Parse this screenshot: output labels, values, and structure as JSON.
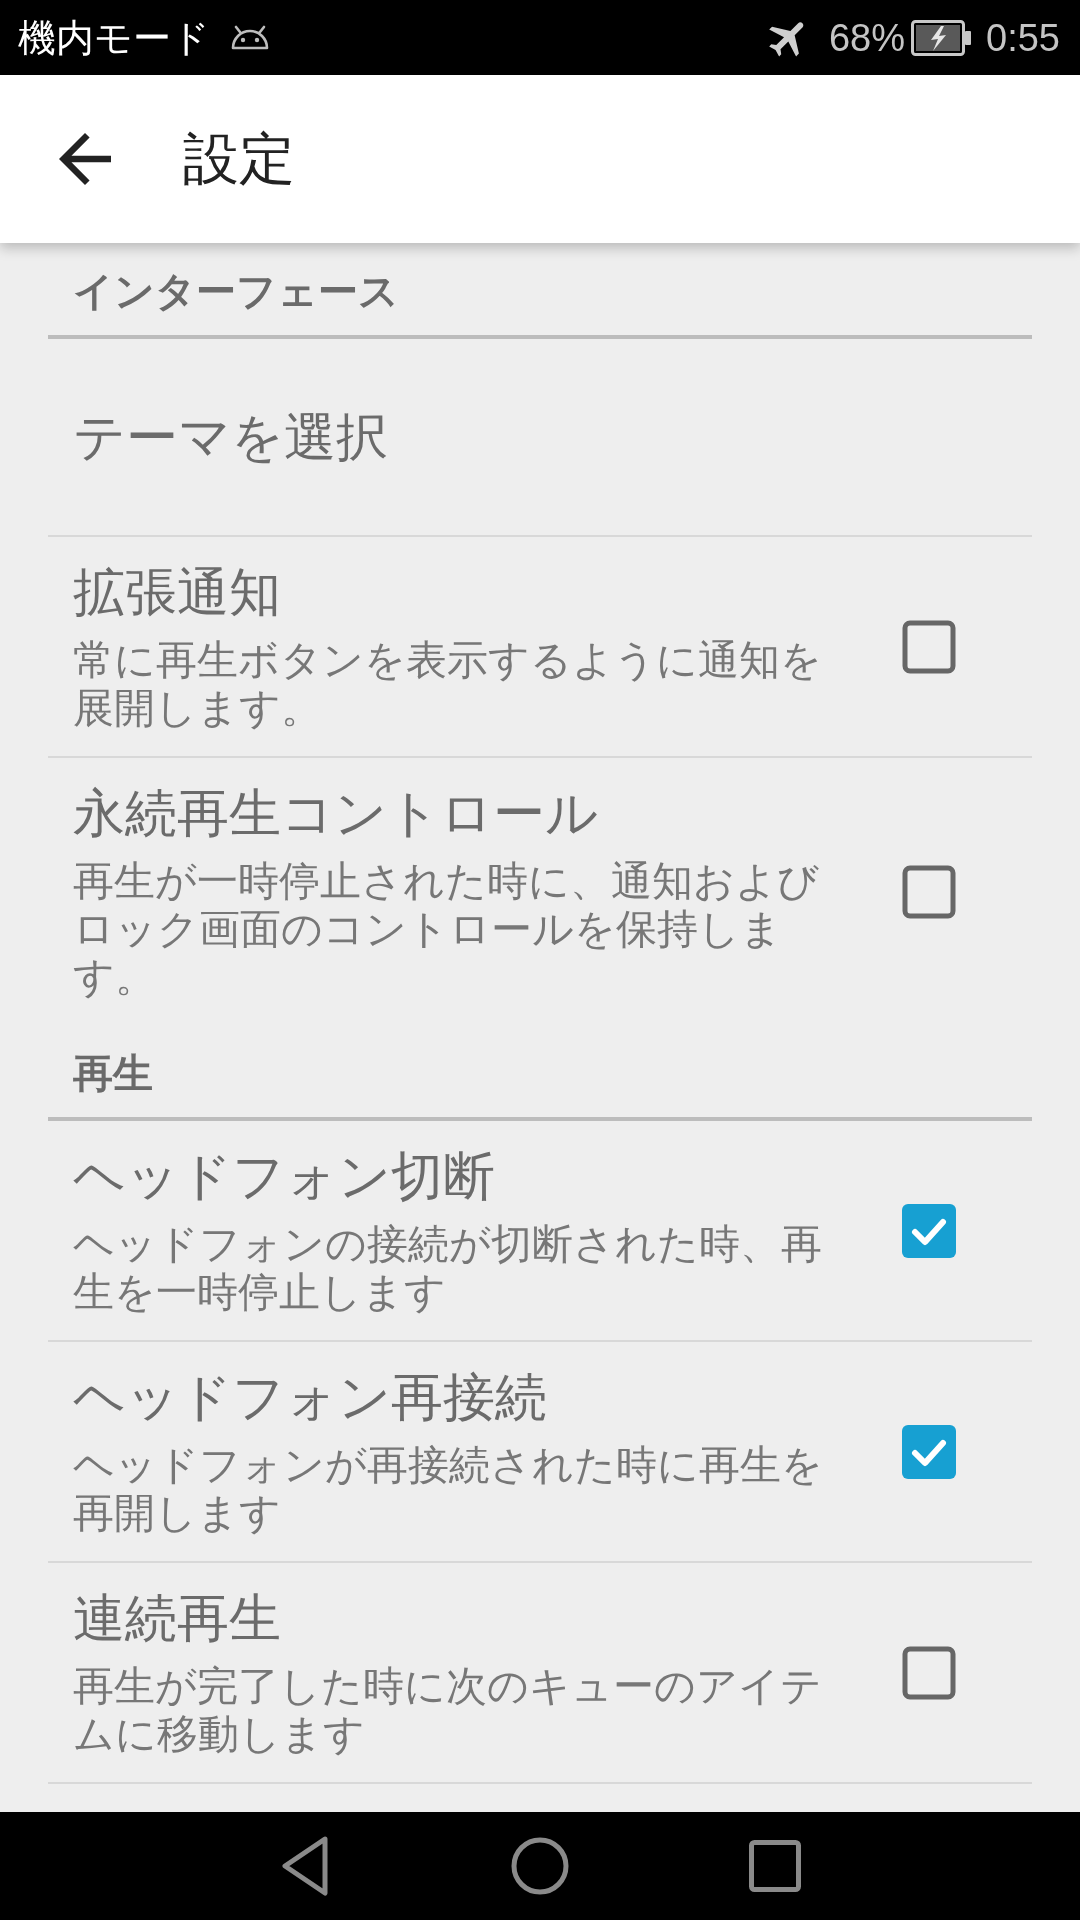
{
  "status_bar": {
    "mode_label": "機内モード",
    "battery_percent": "68%",
    "time": "0:55"
  },
  "app_bar": {
    "title": "設定"
  },
  "sections": [
    {
      "header": "インターフェース",
      "items": [
        {
          "kind": "plain",
          "title": "テーマを選択"
        },
        {
          "kind": "checkbox",
          "title": "拡張通知",
          "summary": "常に再生ボタンを表示するように通知を展開します。",
          "checked": false
        },
        {
          "kind": "checkbox",
          "title": "永続再生コントロール",
          "summary": "再生が一時停止された時に、通知およびロック画面のコントロールを保持します。",
          "checked": false
        }
      ]
    },
    {
      "header": "再生",
      "items": [
        {
          "kind": "checkbox",
          "title": "ヘッドフォン切断",
          "summary": "ヘッドフォンの接続が切断された時、再生を一時停止します",
          "checked": true
        },
        {
          "kind": "checkbox",
          "title": "ヘッドフォン再接続",
          "summary": "ヘッドフォンが再接続された時に再生を再開します",
          "checked": true
        },
        {
          "kind": "checkbox",
          "title": "連続再生",
          "summary": "再生が完了した時に次のキューのアイテムに移動します",
          "checked": false
        }
      ]
    }
  ]
}
